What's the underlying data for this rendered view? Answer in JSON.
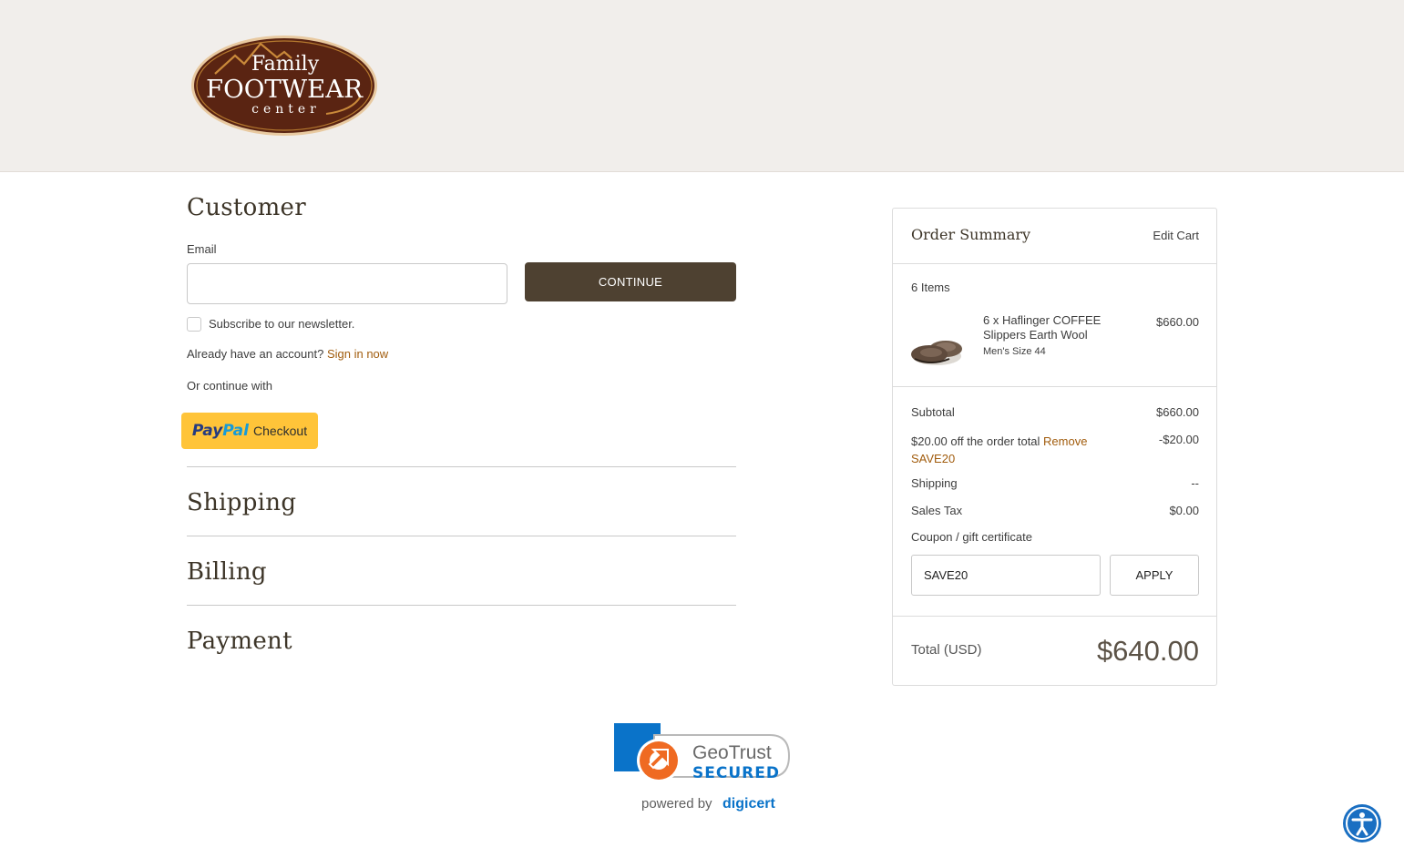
{
  "header": {
    "logo": {
      "line1": "Family",
      "line2": "FOOTWEAR",
      "line3": "center"
    }
  },
  "customer": {
    "title": "Customer",
    "email_label": "Email",
    "email_value": "",
    "continue_label": "CONTINUE",
    "newsletter_label": "Subscribe to our newsletter.",
    "account_prompt": "Already have an account?",
    "sign_in_label": "Sign in now",
    "or_continue": "Or continue with",
    "paypal": {
      "brand_first": "Pay",
      "brand_second": "Pal",
      "label": "Checkout"
    }
  },
  "steps": {
    "shipping": "Shipping",
    "billing": "Billing",
    "payment": "Payment"
  },
  "summary": {
    "title": "Order Summary",
    "edit_cart": "Edit Cart",
    "items_count": "6 Items",
    "item": {
      "name": "6 x Haflinger COFFEE Slippers Earth Wool",
      "option": "Men's Size 44",
      "price": "$660.00"
    },
    "subtotal_label": "Subtotal",
    "subtotal_value": "$660.00",
    "discount_text": "$20.00 off the order total",
    "remove_label": "Remove",
    "discount_code": "SAVE20",
    "discount_value": "-$20.00",
    "shipping_label": "Shipping",
    "shipping_value": "--",
    "tax_label": "Sales Tax",
    "tax_value": "$0.00",
    "coupon_label": "Coupon / gift certificate",
    "coupon_value": "SAVE20",
    "apply_label": "APPLY",
    "total_label": "Total (USD)",
    "total_value": "$640.00"
  },
  "footer": {
    "badge_brand": "GeoTrust",
    "badge_status": "SECURED",
    "powered_by": "powered by",
    "provider": "digicert"
  },
  "colors": {
    "header_bg": "#f1eeeb",
    "button_brown": "#4e4131",
    "link": "#a15c0d",
    "paypal_yellow": "#ffc439",
    "accessibility_blue": "#1a6fc2"
  },
  "icons": {
    "accessibility": "accessibility-icon",
    "checkbox": "checkbox-unchecked"
  }
}
